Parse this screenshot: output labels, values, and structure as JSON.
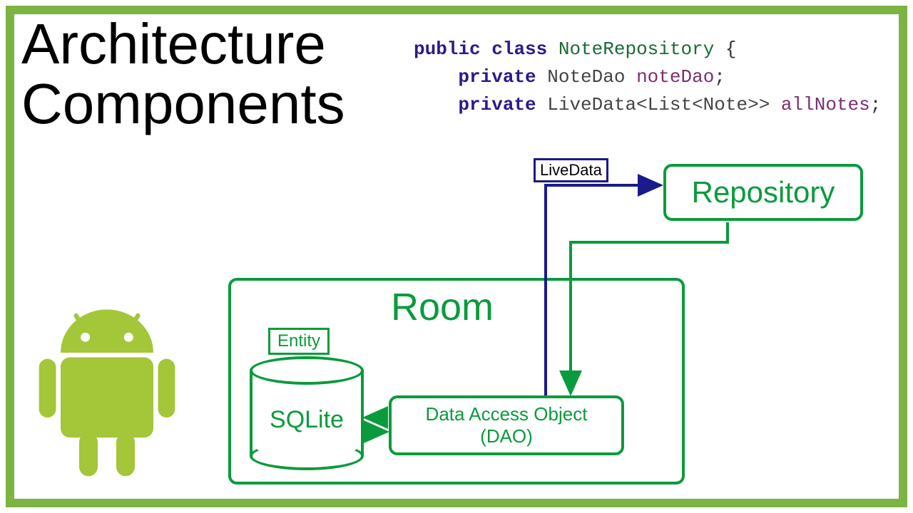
{
  "title_line1": "Architecture",
  "title_line2": "Components",
  "code": {
    "kw_public": "public",
    "kw_class": "class",
    "class_name": "NoteRepository",
    "brace_open": "{",
    "kw_private1": "private",
    "type1": "NoteDao",
    "field1": "noteDao",
    "semi": ";",
    "kw_private2": "private",
    "type2": "LiveData<List<Note>>",
    "field2": "allNotes"
  },
  "diagram": {
    "room": "Room",
    "repository": "Repository",
    "livedata": "LiveData",
    "entity": "Entity",
    "sqlite": "SQLite",
    "dao_line1": "Data Access Object",
    "dao_line2": "(DAO)"
  },
  "colors": {
    "green": "#0a9b3c",
    "blue": "#1a1a8b",
    "android": "#a4c639"
  }
}
